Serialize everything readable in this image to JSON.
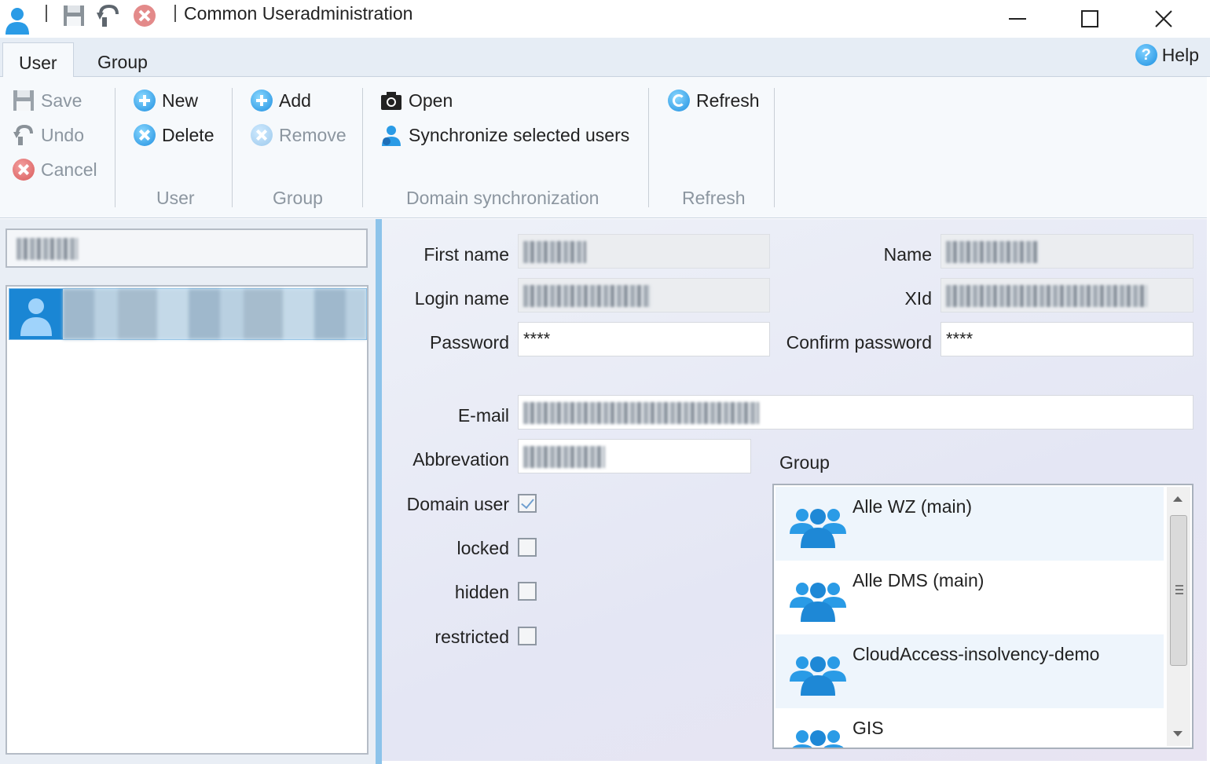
{
  "window": {
    "title": "Common Useradministration",
    "icons": [
      "user-app-icon",
      "save-icon",
      "undo-icon",
      "cancel-icon",
      "minimize-icon",
      "maximize-icon",
      "close-icon"
    ]
  },
  "tabs": [
    {
      "label": "User",
      "active": true
    },
    {
      "label": "Group",
      "active": false
    }
  ],
  "help": {
    "label": "Help"
  },
  "ribbon": {
    "edit": {
      "save": "Save",
      "undo": "Undo",
      "cancel": "Cancel"
    },
    "user": {
      "new": "New",
      "delete": "Delete",
      "group_label": "User"
    },
    "group": {
      "add": "Add",
      "remove": "Remove",
      "group_label": "Group"
    },
    "domain": {
      "open": "Open",
      "sync": "Synchronize selected users",
      "group_label": "Domain synchronization"
    },
    "refresh": {
      "refresh": "Refresh",
      "group_label": "Refresh"
    }
  },
  "form": {
    "first_name_label": "First name",
    "name_label": "Name",
    "login_name_label": "Login name",
    "xid_label": "XId",
    "password_label": "Password",
    "password_value": "****",
    "confirm_password_label": "Confirm password",
    "confirm_password_value": "****",
    "email_label": "E-mail",
    "abbrevation_label": "Abbrevation",
    "domain_user_label": "Domain user",
    "domain_user_checked": true,
    "locked_label": "locked",
    "locked_checked": false,
    "hidden_label": "hidden",
    "hidden_checked": false,
    "restricted_label": "restricted",
    "restricted_checked": false,
    "group_label": "Group"
  },
  "groups": [
    {
      "name": "Alle WZ (main)"
    },
    {
      "name": "Alle DMS (main)"
    },
    {
      "name": "CloudAccess-insolvency-demo"
    },
    {
      "name": "GIS"
    }
  ],
  "colors": {
    "accent": "#1a86d4",
    "selection": "#cfe6f7",
    "splitter": "#8cc3ea"
  }
}
